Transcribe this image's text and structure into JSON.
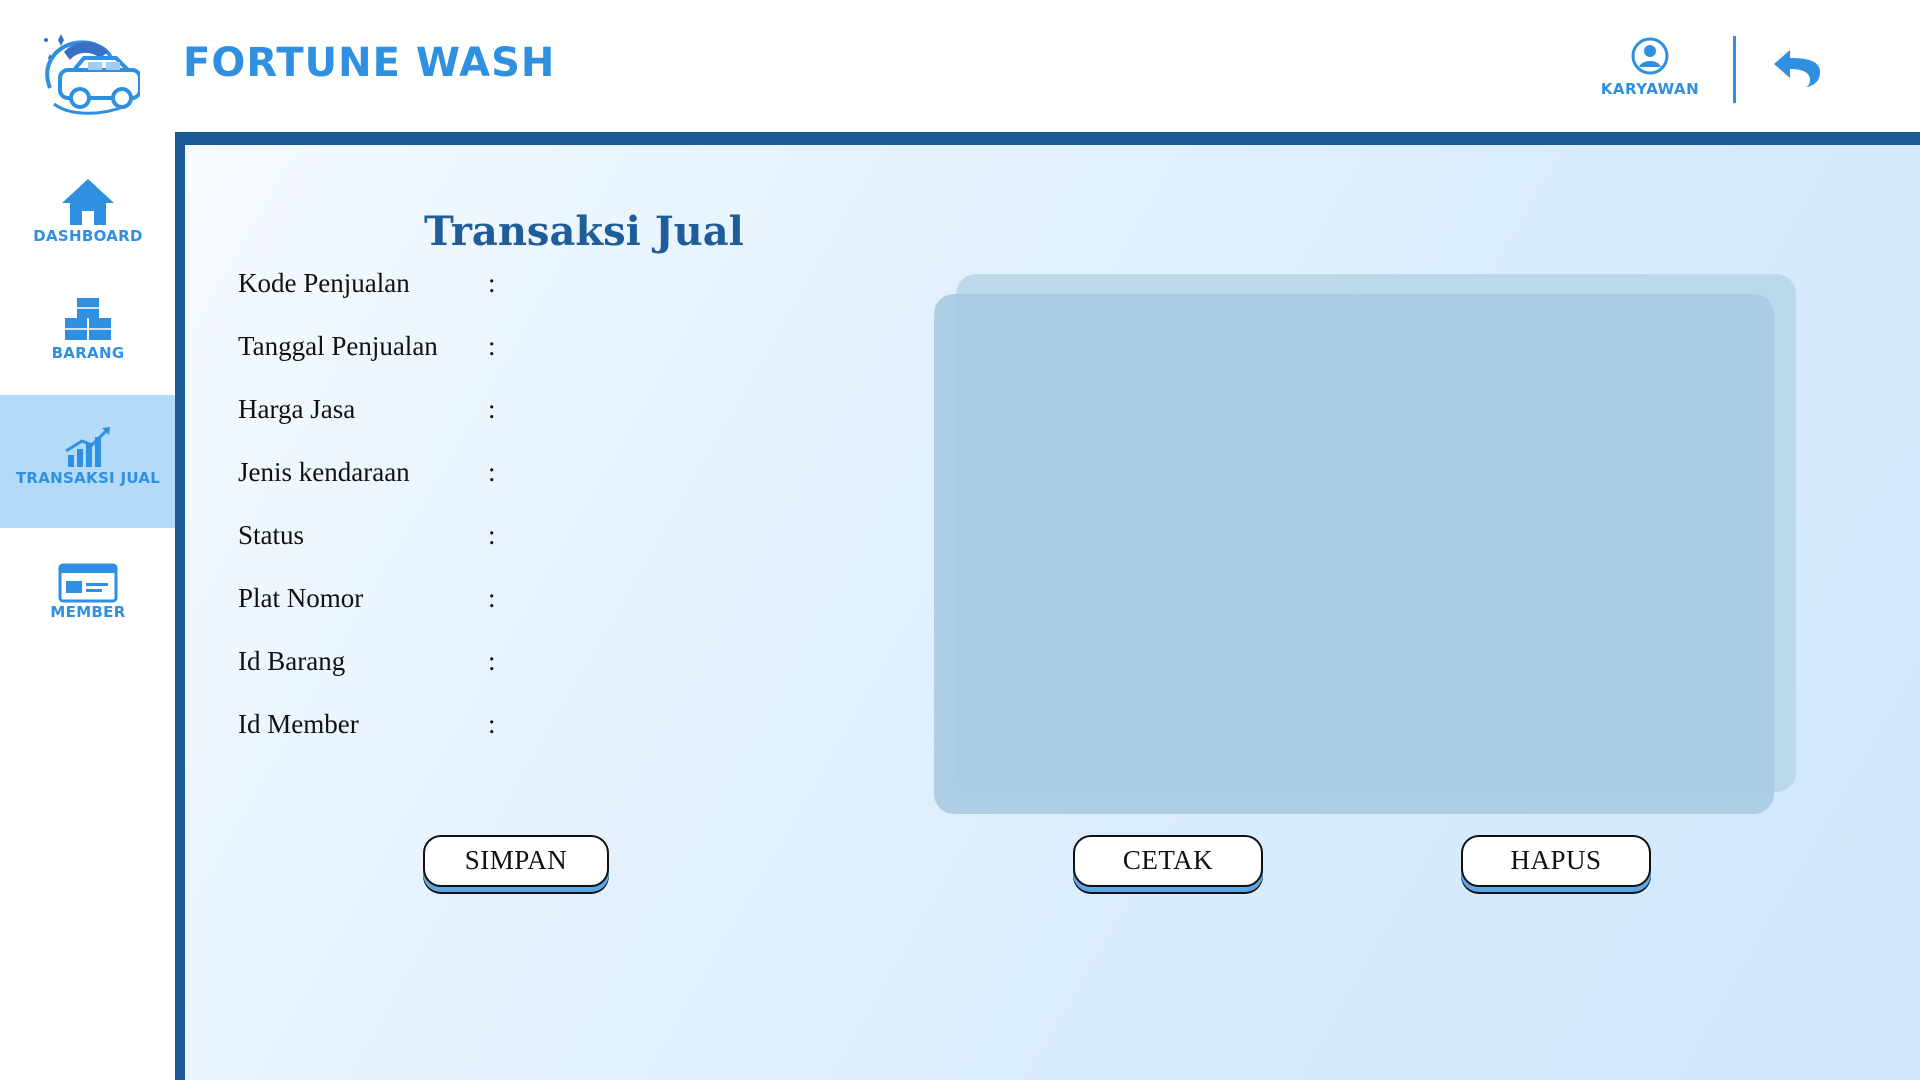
{
  "header": {
    "brand": "FORTUNE WASH",
    "user_label": "KARYAWAN",
    "logo_icon": "car-wash-logo-icon",
    "user_icon": "user-circle-icon",
    "back_icon": "undo-arrow-icon"
  },
  "sidebar": {
    "items": [
      {
        "label": "DASHBOARD",
        "icon": "home-icon",
        "active": false
      },
      {
        "label": "BARANG",
        "icon": "boxes-icon",
        "active": false
      },
      {
        "label": "TRANSAKSI JUAL",
        "icon": "growth-chart-icon",
        "active": true
      },
      {
        "label": "MEMBER",
        "icon": "member-card-icon",
        "active": false
      }
    ]
  },
  "main": {
    "title": "Transaksi Jual",
    "colon": ":",
    "fields": [
      {
        "label": "Kode Penjualan",
        "value": ""
      },
      {
        "label": "Tanggal Penjualan",
        "value": ""
      },
      {
        "label": "Harga Jasa",
        "value": ""
      },
      {
        "label": "Jenis kendaraan",
        "value": ""
      },
      {
        "label": "Status",
        "value": ""
      },
      {
        "label": "Plat Nomor",
        "value": ""
      },
      {
        "label": "Id Barang",
        "value": ""
      },
      {
        "label": "Id Member",
        "value": ""
      }
    ],
    "buttons": {
      "simpan": "SIMPAN",
      "cetak": "CETAK",
      "hapus": "HAPUS"
    }
  },
  "colors": {
    "accent": "#2f8fe0",
    "frame": "#1c5a96",
    "title": "#1f5d98",
    "active_nav": "#b3daf8",
    "preview": "#a9cbe1"
  }
}
